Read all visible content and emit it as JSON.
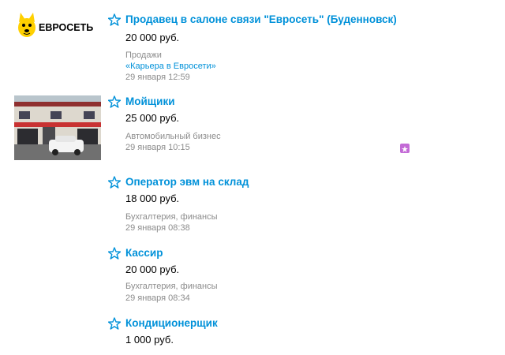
{
  "items": [
    {
      "title": "Продавец в салоне связи \"Евросеть\" (Буденновск)",
      "price": "20 000 руб.",
      "category": "Продажи",
      "sublink": "«Карьера в Евросети»",
      "date": "29 января 12:59",
      "logo_text": "ЕВРОСЕТЬ"
    },
    {
      "title": "Мойщики",
      "price": "25 000 руб.",
      "category": "Автомобильный бизнес",
      "date": "29 января 10:15",
      "promo_icon": "star-badge-icon"
    },
    {
      "title": "Оператор эвм на склад",
      "price": "18 000 руб.",
      "category": "Бухгалтерия, финансы",
      "date": "29 января 08:38"
    },
    {
      "title": "Кассир",
      "price": "20 000 руб.",
      "category": "Бухгалтерия, финансы",
      "date": "29 января 08:34"
    },
    {
      "title": "Кондиционерщик",
      "price": "1 000 руб."
    }
  ],
  "colors": {
    "link": "#0091d9",
    "meta": "#8c8c8c",
    "promo": "#c36ad6"
  }
}
